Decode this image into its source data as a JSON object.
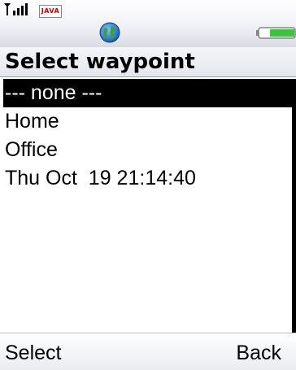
{
  "status_bar": {
    "signal_icon": "signal-strength-icon",
    "java_badge": "JAVA",
    "globe_icon": "globe-icon",
    "battery_icon": "battery-icon"
  },
  "screen": {
    "title": "Select waypoint"
  },
  "waypoints": [
    {
      "label": "--- none ---",
      "selected": true
    },
    {
      "label": "Home",
      "selected": false
    },
    {
      "label": "Office",
      "selected": false
    },
    {
      "label": "Thu Oct  19 21:14:40",
      "selected": false
    }
  ],
  "softkeys": {
    "left": "Select",
    "right": "Back"
  },
  "colors": {
    "selection_bg": "#000000",
    "selection_fg": "#ffffff",
    "battery_green": "#3fc23f"
  }
}
